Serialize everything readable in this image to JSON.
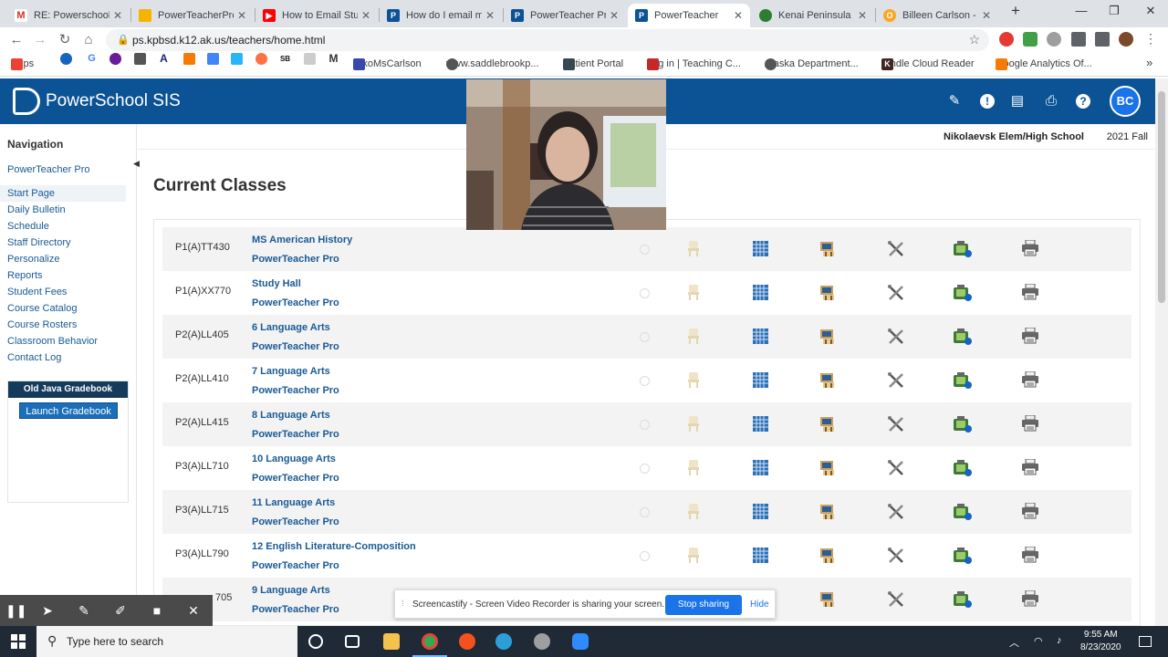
{
  "browser": {
    "tabs": [
      {
        "title": "RE: Powerschool q",
        "favicon": "gmail-icon",
        "color": "#d93025"
      },
      {
        "title": "PowerTeacherPro",
        "favicon": "slides-icon",
        "color": "#f4b400"
      },
      {
        "title": "How to Email Stud",
        "favicon": "youtube-icon",
        "color": "#ff0000"
      },
      {
        "title": "How do I email m",
        "favicon": "powerschool-icon",
        "color": "#0b5394"
      },
      {
        "title": "PowerTeacher Pro",
        "favicon": "powerschool-icon",
        "color": "#0b5394"
      },
      {
        "title": "PowerTeacher",
        "favicon": "powerschool-icon",
        "color": "#0b5394",
        "active": true
      },
      {
        "title": "Kenai Peninsula Bo",
        "favicon": "globe-icon",
        "color": "#2e7d32"
      },
      {
        "title": "Billeen Carlson - C",
        "favicon": "gold-icon",
        "color": "#f9a825"
      }
    ],
    "new_tab": "+",
    "url": "ps.kpbsd.k12.ak.us/teachers/home.html",
    "bookmarks": [
      "Apps",
      "NikoMsCarlson",
      "www.saddlebrookp...",
      "Patient Portal",
      "Log in | Teaching C...",
      "Alaska Department...",
      "Kindle Cloud Reader",
      "Google Analytics Of..."
    ],
    "bookmark_overflow": "»"
  },
  "header": {
    "app_name": "PowerSchool SIS",
    "avatar_initials": "BC"
  },
  "nav": {
    "title": "Navigation",
    "powerteacher_pro": "PowerTeacher Pro",
    "items": [
      "Start Page",
      "Daily Bulletin",
      "Schedule",
      "Staff Directory",
      "Personalize",
      "Reports",
      "Student Fees",
      "Course Catalog",
      "Course Rosters",
      "Classroom Behavior",
      "Contact Log"
    ],
    "gradebook_title": "Old Java Gradebook",
    "launch_label": "Launch Gradebook"
  },
  "school": {
    "name": "Nikolaevsk Elem/High School",
    "term": "2021 Fall"
  },
  "main": {
    "heading": "Current Classes",
    "ptp_label": "PowerTeacher Pro",
    "classes": [
      {
        "code": "P1(A)TT430",
        "name": "MS American History"
      },
      {
        "code": "P1(A)XX770",
        "name": "Study Hall"
      },
      {
        "code": "P2(A)LL405",
        "name": "6 Language Arts"
      },
      {
        "code": "P2(A)LL410",
        "name": "7 Language Arts"
      },
      {
        "code": "P2(A)LL415",
        "name": "8 Language Arts"
      },
      {
        "code": "P3(A)LL710",
        "name": "10 Language Arts"
      },
      {
        "code": "P3(A)LL715",
        "name": "11 Language Arts"
      },
      {
        "code": "P3(A)LL790",
        "name": "12 English Literature-Composition"
      },
      {
        "code": "705",
        "name": "9 Language Arts"
      }
    ]
  },
  "screencastify": {
    "message": "Screencastify - Screen Video Recorder is sharing your screen.",
    "stop_label": "Stop sharing",
    "hide_label": "Hide"
  },
  "taskbar": {
    "search_placeholder": "Type here to search",
    "time": "9:55 AM",
    "date": "8/23/2020"
  }
}
